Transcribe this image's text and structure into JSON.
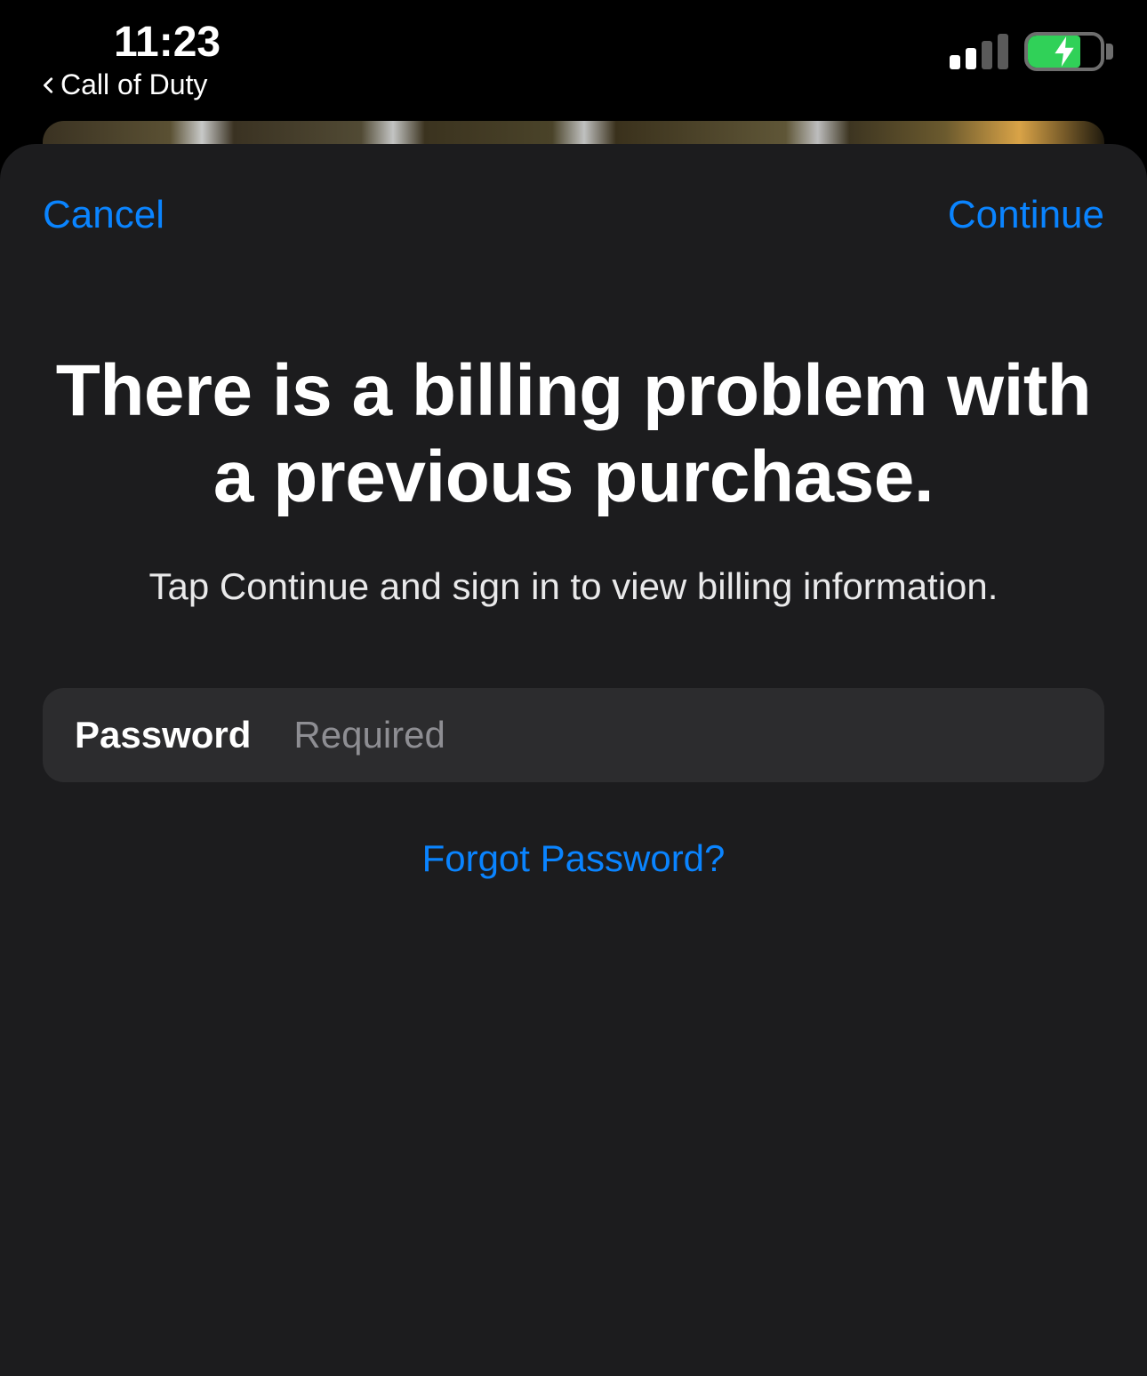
{
  "status_bar": {
    "time": "11:23",
    "back_app": "Call of Duty"
  },
  "sheet": {
    "cancel_label": "Cancel",
    "continue_label": "Continue",
    "title": "There is a billing problem with a previous purchase.",
    "subtitle": "Tap Continue and sign in to view billing information.",
    "password_label": "Password",
    "password_placeholder": "Required",
    "forgot_label": "Forgot Password?"
  },
  "colors": {
    "accent": "#0a84ff",
    "battery_fill": "#30d158"
  }
}
